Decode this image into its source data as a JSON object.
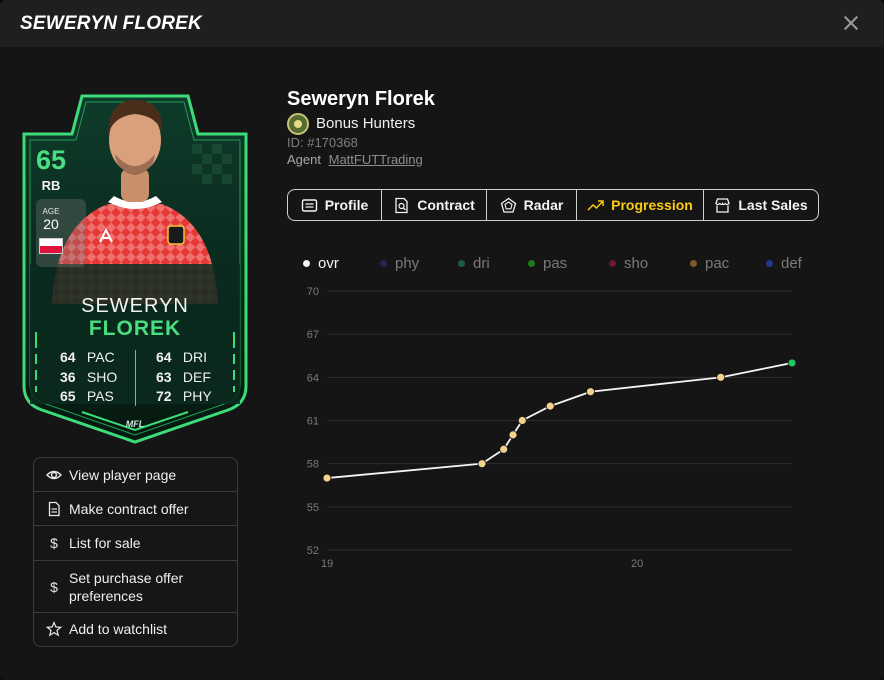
{
  "header": {
    "title": "SEWERYN FLOREK"
  },
  "card": {
    "ovr": "65",
    "position": "RB",
    "age_label": "AGE",
    "age": "20",
    "first_name": "SEWERYN",
    "last_name": "FLOREK",
    "brand": "MFL",
    "stats_left": [
      {
        "value": "64",
        "label": "PAC"
      },
      {
        "value": "36",
        "label": "SHO"
      },
      {
        "value": "65",
        "label": "PAS"
      }
    ],
    "stats_right": [
      {
        "value": "64",
        "label": "DRI"
      },
      {
        "value": "63",
        "label": "DEF"
      },
      {
        "value": "72",
        "label": "PHY"
      }
    ],
    "accent_color": "#4ade80",
    "flag_colors": [
      "#ffffff",
      "#dc143c"
    ]
  },
  "actions": [
    {
      "label": "View player page",
      "icon": "eye-icon"
    },
    {
      "label": "Make contract offer",
      "icon": "document-icon"
    },
    {
      "label": "List for sale",
      "icon": "dollar-icon"
    },
    {
      "label": "Set purchase offer preferences",
      "icon": "dollar-icon"
    },
    {
      "label": "Add to watchlist",
      "icon": "star-icon"
    }
  ],
  "player": {
    "name": "Seweryn Florek",
    "club": "Bonus Hunters",
    "id": "ID: #170368",
    "agent_label": "Agent",
    "agent_name": "MattFUTTrading"
  },
  "tabs": [
    {
      "label": "Profile",
      "icon": "profile-icon",
      "active": false
    },
    {
      "label": "Contract",
      "icon": "contract-icon",
      "active": false
    },
    {
      "label": "Radar",
      "icon": "radar-icon",
      "active": false
    },
    {
      "label": "Progression",
      "icon": "trending-up-icon",
      "active": true
    },
    {
      "label": "Last Sales",
      "icon": "store-icon",
      "active": false
    }
  ],
  "colors": {
    "active_tab": "#facc15",
    "chart_point": "#f2d28c",
    "chart_last_point": "#22c55e"
  },
  "chart_data": {
    "type": "line",
    "legend": [
      {
        "name": "ovr",
        "color": "#f4f4f4",
        "active": true
      },
      {
        "name": "phy",
        "color": "#1e2a4a",
        "active": false
      },
      {
        "name": "dri",
        "color": "#1f5a45",
        "active": false
      },
      {
        "name": "pas",
        "color": "#1f7a1f",
        "active": false
      },
      {
        "name": "sho",
        "color": "#6b1a2a",
        "active": false
      },
      {
        "name": "pac",
        "color": "#7a5a2a",
        "active": false
      },
      {
        "name": "def",
        "color": "#1e3a8a",
        "active": false
      }
    ],
    "x_ticks": [
      19,
      20
    ],
    "xlim": [
      19,
      20.5
    ],
    "ylim": [
      52,
      70
    ],
    "y_ticks": [
      52,
      55,
      58,
      61,
      64,
      67,
      70
    ],
    "grid": true,
    "series": [
      {
        "name": "ovr",
        "points": [
          [
            19.0,
            57
          ],
          [
            19.5,
            58
          ],
          [
            19.57,
            59
          ],
          [
            19.6,
            60
          ],
          [
            19.63,
            61
          ],
          [
            19.72,
            62
          ],
          [
            19.85,
            63
          ],
          [
            20.27,
            64
          ],
          [
            20.5,
            65
          ]
        ]
      }
    ]
  }
}
